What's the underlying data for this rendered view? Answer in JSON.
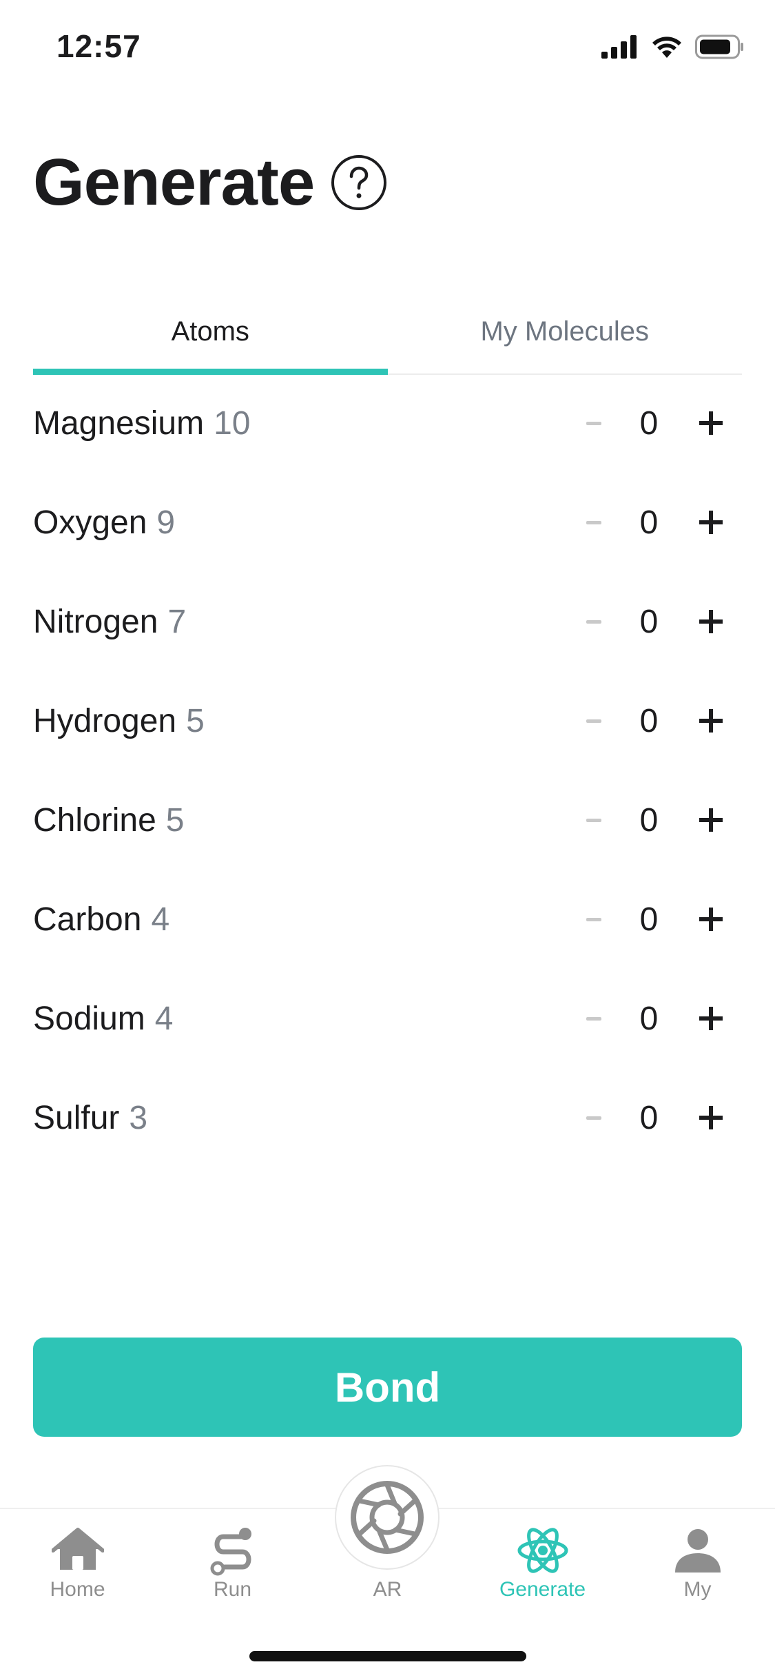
{
  "status_bar": {
    "time": "12:57",
    "icons": [
      "cellular-signal-icon",
      "wifi-icon",
      "battery-icon"
    ]
  },
  "header": {
    "title": "Generate",
    "help_icon": "question-circle-icon"
  },
  "tabs": [
    {
      "label": "Atoms",
      "active": true
    },
    {
      "label": "My Molecules",
      "active": false
    }
  ],
  "atoms": [
    {
      "name": "Magnesium",
      "available": "10",
      "count": "0"
    },
    {
      "name": "Oxygen",
      "available": "9",
      "count": "0"
    },
    {
      "name": "Nitrogen",
      "available": "7",
      "count": "0"
    },
    {
      "name": "Hydrogen",
      "available": "5",
      "count": "0"
    },
    {
      "name": "Chlorine",
      "available": "5",
      "count": "0"
    },
    {
      "name": "Carbon",
      "available": "4",
      "count": "0"
    },
    {
      "name": "Sodium",
      "available": "4",
      "count": "0"
    },
    {
      "name": "Sulfur",
      "available": "3",
      "count": "0"
    }
  ],
  "bond_button": {
    "label": "Bond"
  },
  "tab_bar": {
    "items": [
      {
        "label": "Home",
        "icon": "home-icon",
        "active": false
      },
      {
        "label": "Run",
        "icon": "route-icon",
        "active": false
      },
      {
        "label": "AR",
        "icon": "camera-aperture-icon",
        "active": false
      },
      {
        "label": "Generate",
        "icon": "atom-icon",
        "active": true
      },
      {
        "label": "My",
        "icon": "person-icon",
        "active": false
      }
    ]
  },
  "colors": {
    "accent": "#2ec4b6",
    "text_primary": "#1c1c1e",
    "text_secondary": "#7a8089",
    "tab_inactive": "#8e8e8e"
  }
}
